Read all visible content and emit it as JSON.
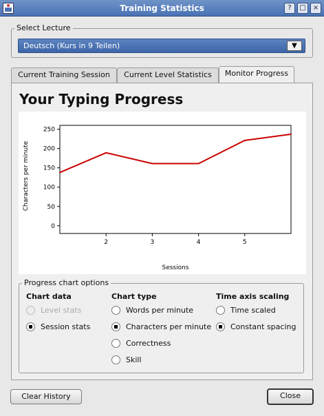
{
  "window": {
    "title": "Training Statistics"
  },
  "lecture_select": {
    "legend": "Select Lecture",
    "value": "Deutsch (Kurs in 9 Teilen)"
  },
  "tabs": [
    {
      "label": "Current Training Session"
    },
    {
      "label": "Current Level Statistics"
    },
    {
      "label": "Monitor Progress"
    }
  ],
  "panel": {
    "heading": "Your Typing Progress"
  },
  "chart_data": {
    "type": "line",
    "title": "",
    "xlabel": "Sessions",
    "ylabel": "Characters per minute",
    "x": [
      1,
      2,
      3,
      4,
      5,
      6
    ],
    "series": [
      {
        "values": [
          138,
          189,
          161,
          161,
          221,
          237
        ]
      }
    ],
    "xlim": [
      1,
      6
    ],
    "ylim": [
      -20,
      260
    ],
    "xticks": [
      "2",
      "3",
      "4",
      "5"
    ],
    "yticks": [
      "250",
      "200",
      "150",
      "100",
      "50",
      "0"
    ],
    "line_color": "#cc0000",
    "grid": false
  },
  "options": {
    "legend": "Progress chart options",
    "chart_data_label": "Chart data",
    "chart_data_options": [
      {
        "label": "Level stats",
        "checked": false,
        "disabled": true
      },
      {
        "label": "Session stats",
        "checked": true,
        "disabled": false
      }
    ],
    "chart_type_label": "Chart type",
    "chart_type_options": [
      {
        "label": "Words per minute",
        "checked": false
      },
      {
        "label": "Characters per minute",
        "checked": true
      },
      {
        "label": "Correctness",
        "checked": false
      },
      {
        "label": "Skill",
        "checked": false
      }
    ],
    "time_axis_label": "Time axis scaling",
    "time_axis_options": [
      {
        "label": "Time scaled",
        "checked": false
      },
      {
        "label": "Constant spacing",
        "checked": true
      }
    ]
  },
  "buttons": {
    "clear_history": "Clear History",
    "close": "Close"
  }
}
